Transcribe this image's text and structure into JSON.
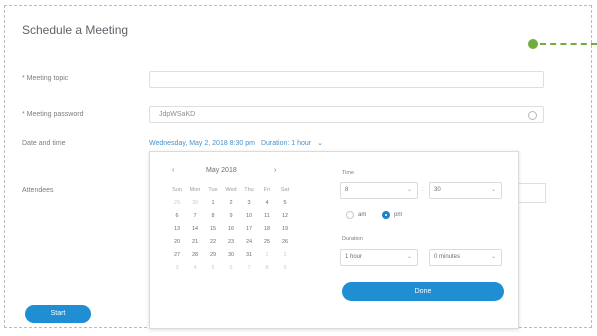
{
  "page": {
    "title": "Schedule a Meeting"
  },
  "form": {
    "topic_label": "* Meeting topic",
    "topic_value": "",
    "password_label": "* Meeting password",
    "password_value": "JdpWSaKD",
    "datetime_label": "Date and time",
    "datetime_value": "Wednesday, May 2, 2018 8:30 pm",
    "duration_text": "Duration: 1 hour",
    "attendees_label": "Attendees",
    "start_button": "Start"
  },
  "picker": {
    "prev": "‹",
    "next": "›",
    "month_label": "May 2018",
    "weekdays": [
      "Sun",
      "Mon",
      "Tue",
      "Wed",
      "Thu",
      "Fri",
      "Sat"
    ],
    "days": [
      {
        "d": "29",
        "dim": true
      },
      {
        "d": "30",
        "dim": true
      },
      {
        "d": "1"
      },
      {
        "d": "2"
      },
      {
        "d": "3"
      },
      {
        "d": "4"
      },
      {
        "d": "5"
      },
      {
        "d": "6"
      },
      {
        "d": "7"
      },
      {
        "d": "8"
      },
      {
        "d": "9"
      },
      {
        "d": "10"
      },
      {
        "d": "11"
      },
      {
        "d": "12"
      },
      {
        "d": "13"
      },
      {
        "d": "14"
      },
      {
        "d": "15"
      },
      {
        "d": "16"
      },
      {
        "d": "17"
      },
      {
        "d": "18"
      },
      {
        "d": "19"
      },
      {
        "d": "20"
      },
      {
        "d": "21"
      },
      {
        "d": "22"
      },
      {
        "d": "23"
      },
      {
        "d": "24"
      },
      {
        "d": "25"
      },
      {
        "d": "26"
      },
      {
        "d": "27"
      },
      {
        "d": "28"
      },
      {
        "d": "29"
      },
      {
        "d": "30"
      },
      {
        "d": "31"
      },
      {
        "d": "1",
        "dim": true
      },
      {
        "d": "2",
        "dim": true
      },
      {
        "d": "3",
        "dim": true
      },
      {
        "d": "4",
        "dim": true
      },
      {
        "d": "5",
        "dim": true
      },
      {
        "d": "6",
        "dim": true
      },
      {
        "d": "7",
        "dim": true
      },
      {
        "d": "8",
        "dim": true
      },
      {
        "d": "9",
        "dim": true
      }
    ],
    "time_label": "Time",
    "hour": "8",
    "minute": "30",
    "am_label": "am",
    "pm_label": "pm",
    "ampm_selected": "pm",
    "duration_label": "Duration",
    "duration_hours": "1 hour",
    "duration_minutes": "0 minutes",
    "done_button": "Done"
  },
  "colors": {
    "accent": "#1f8ed2",
    "link": "#4a90c8",
    "connector": "#6fae3a"
  },
  "icons": {
    "password_toggle": "eye-icon"
  }
}
